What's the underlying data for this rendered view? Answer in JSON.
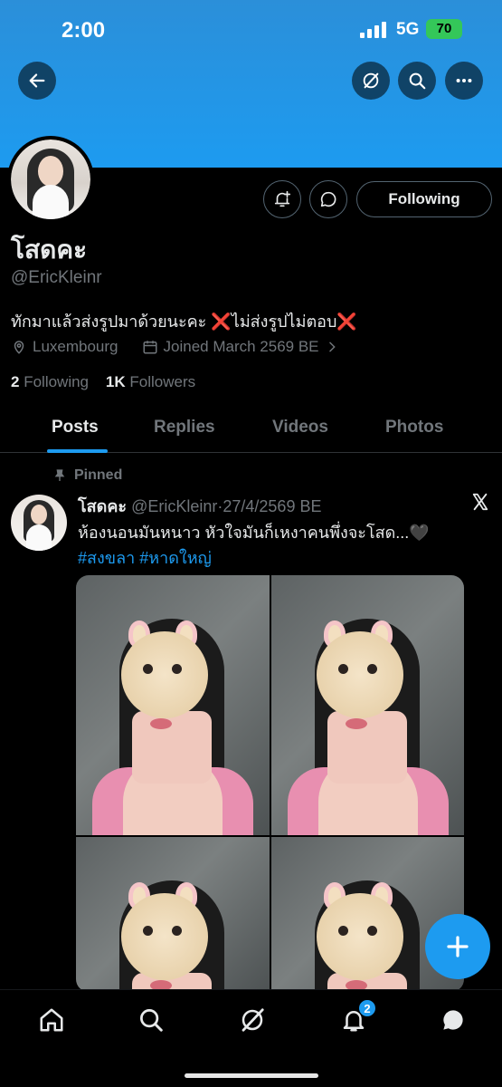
{
  "status_bar": {
    "time": "2:00",
    "network": "5G",
    "battery": "70"
  },
  "header": {
    "back_icon": "back-arrow-icon",
    "actions": [
      "grok-icon",
      "search-icon",
      "more-icon"
    ]
  },
  "profile": {
    "name": "โสดคะ",
    "handle": "@EricKleinr",
    "bio_text_1": "ทักมาแล้วส่งรูปมาด้วยนะคะ ",
    "bio_emoji": "❌",
    "bio_text_2": "ไม่ส่งรูปไม่ตอบ",
    "location": "Luxembourg",
    "joined": "Joined March 2569 BE",
    "following_count": "2",
    "following_label": "Following",
    "followers_count": "1K",
    "followers_label": "Followers",
    "follow_button": "Following"
  },
  "tabs": [
    "Posts",
    "Replies",
    "Videos",
    "Photos"
  ],
  "active_tab": "Posts",
  "pinned_label": "Pinned",
  "post": {
    "author": "โสดคะ",
    "handle": "@EricKleinr",
    "separator": "·",
    "date": "27/4/2569 BE",
    "text": "ห้องนอนมันหนาว หัวใจมันก็เหงาคนพึ่งจะโสด...🖤",
    "tags": "#สงขลา #หาดใหญ่"
  },
  "bottom_nav": [
    "home-icon",
    "search-icon",
    "grok-icon",
    "notifications-icon",
    "messages-icon"
  ],
  "notification_badge": "2",
  "colors": {
    "accent": "#1d9bf0",
    "background": "#000000",
    "muted": "#71767b",
    "banner": "#1d9bf0"
  }
}
